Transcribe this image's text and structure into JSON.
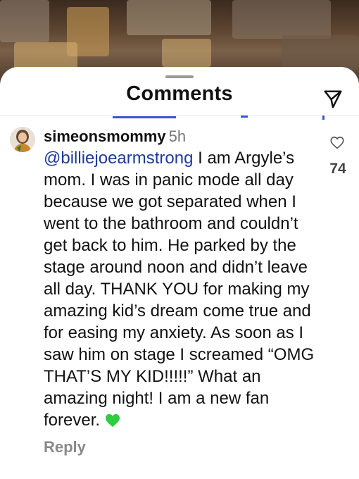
{
  "sheet": {
    "title": "Comments"
  },
  "comment": {
    "username": "simeonsmommy",
    "time": "5h",
    "mention": "@billiejoearmstrong",
    "text": " I am Argyle’s mom. I was in panic mode all day because we got separated when I went to the bathroom and couldn’t get back to him. He parked by the stage around noon and didn’t leave all day. THANK YOU for making my amazing kid’s dream come true and for easing my anxiety. As soon as I saw him on stage I screamed “OMG THAT’S MY KID!!!!!” What an amazing night! I am a new fan forever. ",
    "emoji": "green-heart",
    "like_count": "74",
    "reply_label": "Reply"
  },
  "icons": {
    "send": "paper-plane-icon",
    "like": "heart-outline-icon"
  },
  "colors": {
    "mention": "#1d3b9a",
    "emoji_heart": "#2ecc40",
    "muted": "#8a8a8a"
  }
}
